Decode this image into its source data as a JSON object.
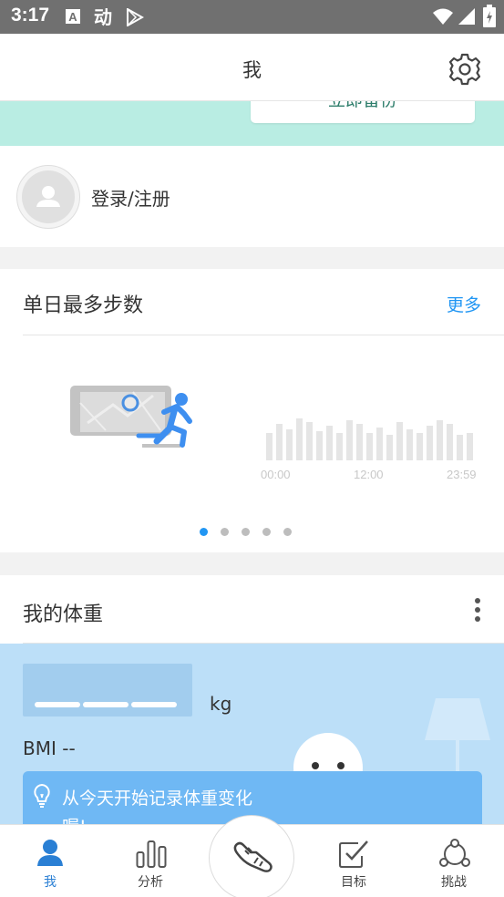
{
  "status_bar": {
    "time": "3:17",
    "app_icons": [
      "a-box-icon",
      "dong-app-icon",
      "play-store-icon"
    ],
    "system_icons": [
      "wifi-icon",
      "signal-icon",
      "battery-icon"
    ]
  },
  "header": {
    "title": "我",
    "settings_icon": "gear-icon"
  },
  "backup_banner": {
    "button_label": "立即备份"
  },
  "account": {
    "label": "登录/注册"
  },
  "steps_card": {
    "title": "单日最多步数",
    "more_label": "更多",
    "axis_labels": [
      "00:00",
      "12:00",
      "23:59"
    ],
    "page_count": 5,
    "active_page": 1
  },
  "weight_card": {
    "title": "我的体重",
    "unit": "kg",
    "bmi": "BMI --",
    "tip_line1": "从今天开始记录体重变化",
    "tip_line2": "喔!"
  },
  "bottom_nav": {
    "items": [
      {
        "label": "我",
        "icon": "person-icon",
        "active": true
      },
      {
        "label": "分析",
        "icon": "bar-chart-icon",
        "active": false
      },
      {
        "label": "",
        "icon": "shoe-icon",
        "active": false
      },
      {
        "label": "目标",
        "icon": "target-check-icon",
        "active": false
      },
      {
        "label": "挑战",
        "icon": "challenge-icon",
        "active": false
      }
    ]
  },
  "colors": {
    "accent": "#2196f3",
    "mint": "#b9ede3",
    "weight_panel": "#bcdff8",
    "tip_bg": "#6fb8f4"
  }
}
